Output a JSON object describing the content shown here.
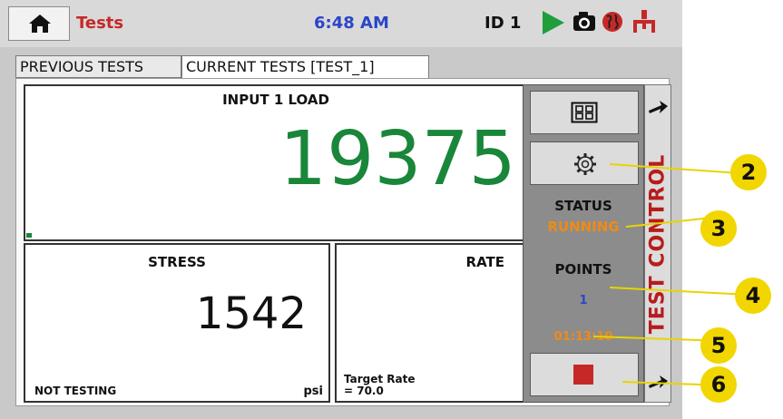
{
  "header": {
    "title": "Tests",
    "time": "6:48 AM",
    "id_label": "ID 1",
    "icons": [
      "home-icon",
      "play-icon",
      "camera-icon",
      "globe-icon",
      "network-icon"
    ]
  },
  "tabs": [
    {
      "label": "PREVIOUS TESTS",
      "active": false
    },
    {
      "label": "CURRENT TESTS [TEST_1]",
      "active": true
    }
  ],
  "load_panel": {
    "title": "INPUT 1 LOAD",
    "value": "19375",
    "bar_level": 0.03
  },
  "stress_panel": {
    "title": "STRESS",
    "value": "1542",
    "unit": "psi",
    "status": "NOT TESTING"
  },
  "rate_panel": {
    "title": "RATE",
    "target_label": "Target Rate",
    "target_value": "= 70.0"
  },
  "control": {
    "status_label": "STATUS",
    "status_value": "RUNNING",
    "points_label": "POINTS",
    "points_value": "1",
    "elapsed": "01:13:10",
    "side_label": "TEST CONTROL",
    "buttons": [
      "layout-grid-icon",
      "gear-icon",
      "stop-icon"
    ]
  },
  "callouts": [
    "2",
    "3",
    "4",
    "5",
    "6"
  ],
  "colors": {
    "green": "#19863a",
    "orange": "#f08a16",
    "red": "#c62828",
    "blue": "#2b45c7",
    "callout": "#f2d600"
  }
}
